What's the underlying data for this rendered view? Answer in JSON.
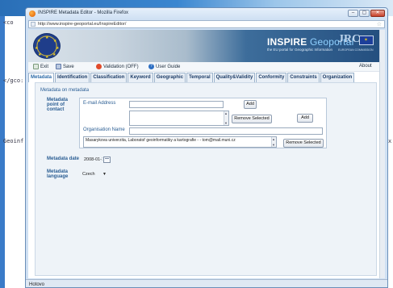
{
  "background": {
    "code_left_top": "<co",
    "code_left_mid": "</gco:",
    "code_left_low": "Geoinf",
    "code_right_mid": "",
    "code_right_low": "x"
  },
  "window": {
    "title": "INSPIRE Metadata Editor - Mozilla Firefox",
    "controls": [
      "–",
      "▢",
      "✕"
    ]
  },
  "address_bar": {
    "url": "http://www.inspire-geoportal.eu/InspireEditor/"
  },
  "banner": {
    "inspire_main": "INSPIRE",
    "inspire_light": "Geoportal",
    "inspire_sub": "the EU portal for Geographic Information",
    "jrc": "JRC",
    "jrc_sub": "EUROPEAN COMMISSION"
  },
  "toolbar": {
    "exit": "Exit",
    "save": "Save",
    "validation": "Validation (OFF)",
    "user_guide": "User Guide",
    "about": "About"
  },
  "tabs": [
    "Metadata",
    "Identification",
    "Classification",
    "Keyword",
    "Geographic",
    "Temporal",
    "Quality&Validity",
    "Conformity",
    "Constraints",
    "Organization"
  ],
  "active_tab": "Metadata",
  "form": {
    "section_title": "Metadata on metadata",
    "point_of_contact_label": "Metadata point of contact",
    "email_label": "E-mail Address",
    "email_value": "",
    "add_email_button": "Add",
    "remove_email_button": "Remove Selected",
    "add_contact_button": "Add",
    "organisation_label": "Organisation Name",
    "organisation_value": "",
    "organisation_list_value": "Masarykova univerzita, Laboratoř geoinformatiky a kartografie - - tom@mail.muni.cz",
    "remove_org_button": "Remove Selected",
    "metadata_date_label": "Metadata date",
    "metadata_date_value": "2008-01-14",
    "metadata_language_label": "Metadata language",
    "metadata_language_value": "Czech"
  },
  "status_bar": {
    "text": "Hotovo"
  }
}
